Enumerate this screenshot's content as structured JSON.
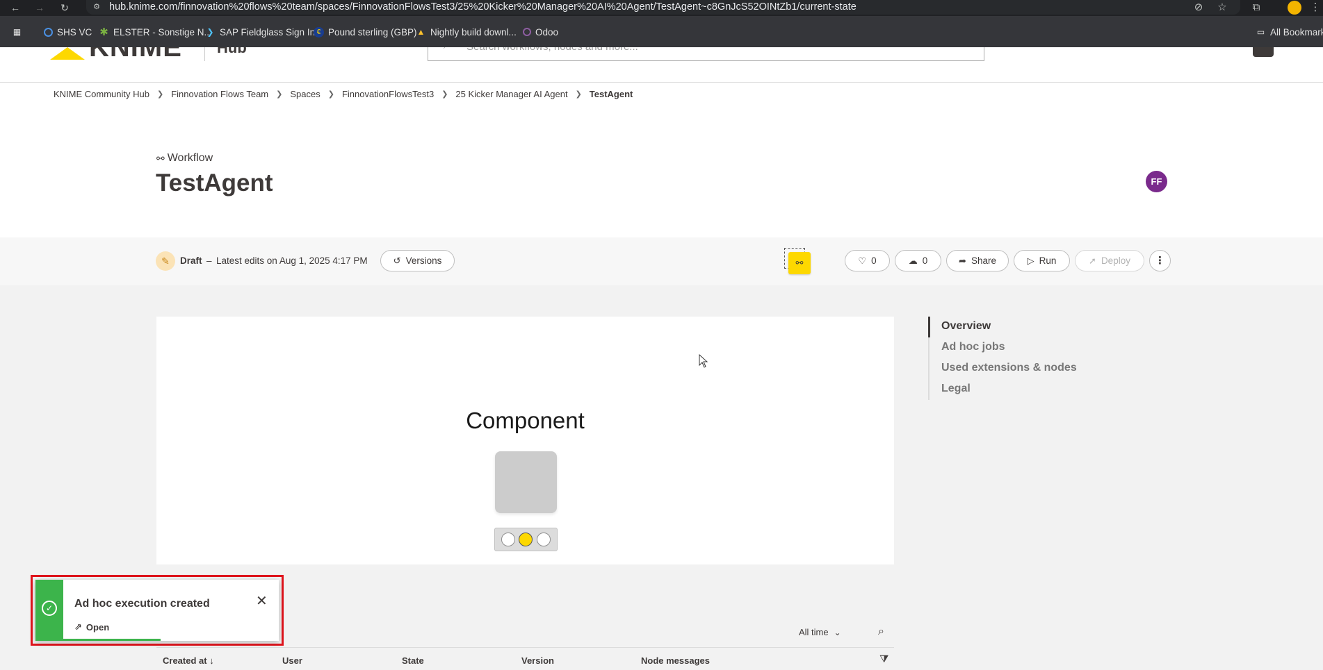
{
  "browser": {
    "url": "hub.knime.com/finnovation%20flows%20team/spaces/FinnovationFlowsTest3/25%20Kicker%20Manager%20AI%20Agent/TestAgent~c8GnJcS52OINtZb1/current-state",
    "bookmarks": [
      {
        "label": "SHS VC",
        "icon": "globe-icon",
        "color": "#4a90e2"
      },
      {
        "label": "ELSTER - Sonstige N...",
        "icon": "star-leaf-icon",
        "color": "#7cb342"
      },
      {
        "label": "SAP Fieldglass Sign In",
        "icon": "sap-icon",
        "color": "#4fc3f7"
      },
      {
        "label": "Pound sterling (GBP)",
        "icon": "euro-icon",
        "color": "#1a3d8f"
      },
      {
        "label": "Nightly build downl...",
        "icon": "warning-triangle-icon",
        "color": "#fbc02d"
      },
      {
        "label": "Odoo",
        "icon": "circle-icon",
        "color": "#8e5ea2"
      }
    ],
    "all_bookmarks": "All Bookmarks"
  },
  "header": {
    "search_placeholder": "Search workflows, nodes and more...",
    "logo_text": "KNIME",
    "logo_sub": "Hub"
  },
  "breadcrumb": [
    "KNIME Community Hub",
    "Finnovation Flows Team",
    "Spaces",
    "FinnovationFlowsTest3",
    "25 Kicker Manager AI Agent",
    "TestAgent"
  ],
  "item": {
    "type": "Workflow",
    "title": "TestAgent",
    "owner_initials": "FF",
    "owner_color": "#7a2a8c"
  },
  "toolbar": {
    "status": "Draft",
    "dash": "–",
    "latest_edits": "Latest edits on Aug 1, 2025 4:17 PM",
    "versions": "Versions",
    "likes": "0",
    "downloads": "0",
    "share": "Share",
    "run": "Run",
    "deploy": "Deploy"
  },
  "canvas": {
    "component_title": "Component",
    "traffic_light_state": "yellow"
  },
  "side_nav": [
    {
      "label": "Overview",
      "active": true
    },
    {
      "label": "Ad hoc jobs",
      "active": false
    },
    {
      "label": "Used extensions & nodes",
      "active": false
    },
    {
      "label": "Legal",
      "active": false
    }
  ],
  "jobs": {
    "time_filter": "All time",
    "columns": [
      "Created at",
      "User",
      "State",
      "Version",
      "Node messages"
    ]
  },
  "toast": {
    "title": "Ad hoc execution created",
    "link": "Open",
    "accent": "#3cb44b"
  }
}
